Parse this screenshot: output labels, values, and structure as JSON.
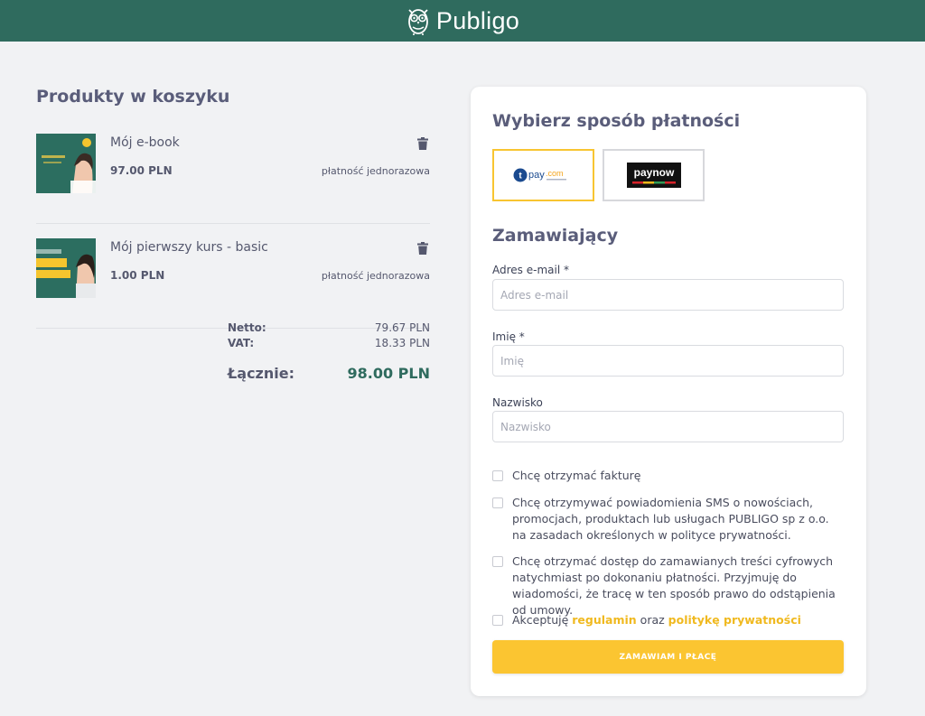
{
  "header": {
    "brand": "Publigo"
  },
  "cart": {
    "title": "Produkty w koszyku",
    "items": [
      {
        "name": "Mój e-book",
        "price": "97.00 PLN",
        "payment_type": "płatność jednorazowa"
      },
      {
        "name": "Mój pierwszy kurs - basic",
        "price": "1.00 PLN",
        "payment_type": "płatność jednorazowa"
      }
    ],
    "totals": {
      "net_label": "Netto:",
      "net_value": "79.67 PLN",
      "vat_label": "VAT:",
      "vat_value": "18.33 PLN",
      "total_label": "Łącznie:",
      "total_value": "98.00 PLN"
    }
  },
  "payment": {
    "title": "Wybierz sposób płatności",
    "options": [
      {
        "name": "tpay.com",
        "selected": true
      },
      {
        "name": "paynow",
        "selected": false
      }
    ]
  },
  "customer": {
    "title": "Zamawiający",
    "email": {
      "label": "Adres e-mail *",
      "placeholder": "Adres e-mail",
      "value": ""
    },
    "first_name": {
      "label": "Imię *",
      "placeholder": "Imię",
      "value": ""
    },
    "last_name": {
      "label": "Nazwisko",
      "placeholder": "Nazwisko",
      "value": ""
    }
  },
  "consents": {
    "invoice": "Chcę otrzymać fakturę",
    "sms": "Chcę otrzymywać powiadomienia SMS o nowościach, promocjach, produktach lub usługach PUBLIGO sp z o.o. na zasadach określonych w polityce prywatności.",
    "digital": "Chcę otrzymać dostęp do zamawianych treści cyfrowych natychmiast po dokonaniu płatności. Przyjmuję do wiadomości, że tracę w ten sposób prawo do odstąpienia od umowy.",
    "terms_prefix": "Akceptuję",
    "terms_link": "regulamin",
    "terms_mid": "oraz",
    "privacy_link": "politykę prywatności"
  },
  "submit_label": "ZAMAWIAM I PŁACĘ",
  "colors": {
    "header": "#2f6b5e",
    "accent": "#fbc531",
    "total": "#2f6b5e"
  }
}
